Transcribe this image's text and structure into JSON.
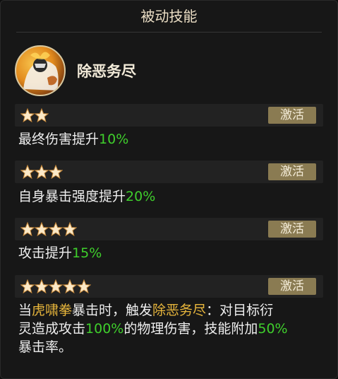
{
  "panel": {
    "title": "被动技能",
    "skill_name": "除恶务尽",
    "activate_label": "激活",
    "colors": {
      "highlight_green": "#3fcf2c",
      "highlight_gold": "#e9b73c",
      "button_bg": "#8a7b52"
    },
    "tiers": [
      {
        "stars": 2,
        "text_plain": "最终伤害提升",
        "value": "10%"
      },
      {
        "stars": 3,
        "text_plain": "自身暴击强度提升",
        "value": "20%"
      },
      {
        "stars": 4,
        "text_plain": "攻击提升",
        "value": "15%"
      },
      {
        "stars": 5,
        "parts": [
          "当",
          "虎啸拳",
          "暴击时，触发",
          "除恶务尽",
          "：对目标衍",
          "灵造成攻击",
          "100%",
          "的物理伤害，技能附加",
          "50%",
          "暴击率。"
        ]
      }
    ]
  }
}
